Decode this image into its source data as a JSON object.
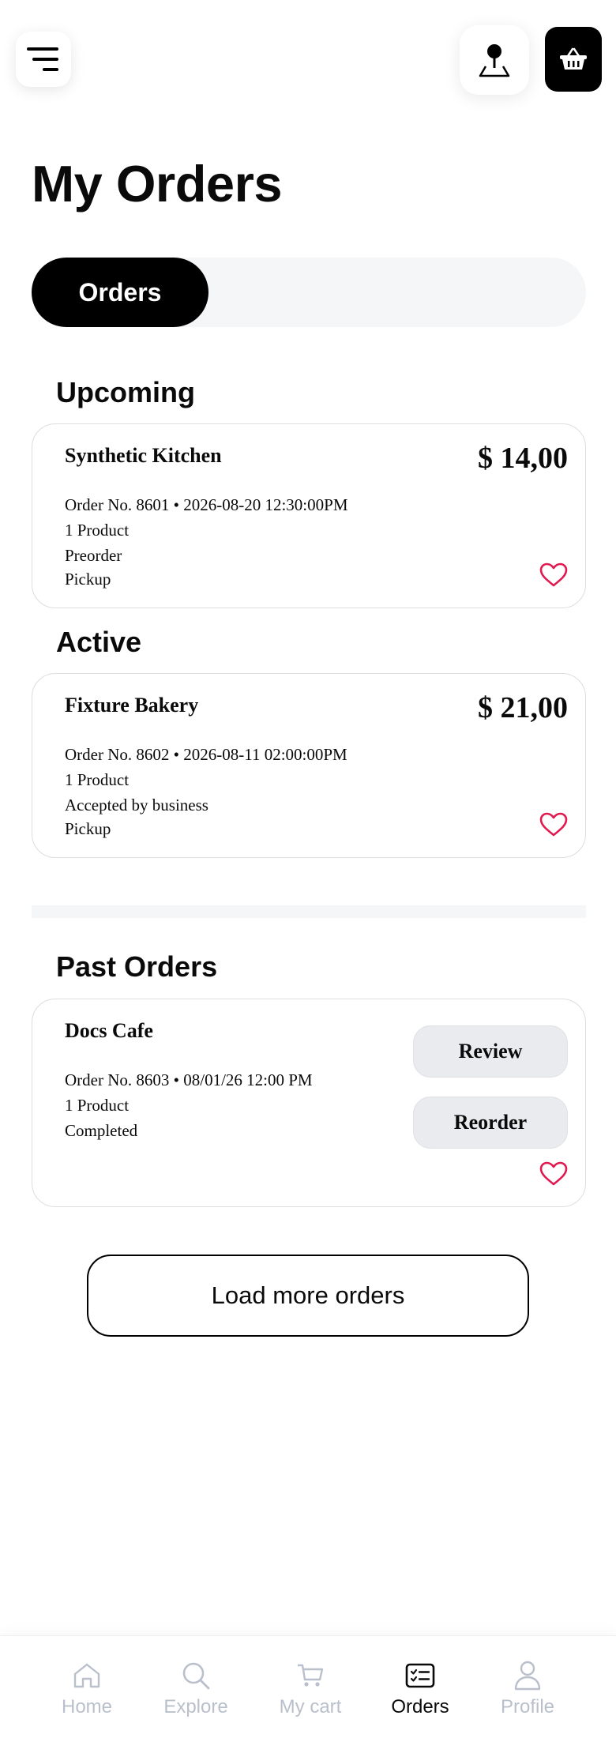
{
  "header": {
    "menu_icon": "menu-icon",
    "location_icon": "map-pin-icon",
    "cart_icon": "basket-icon"
  },
  "page_title": "My Orders",
  "tabs": [
    {
      "label": "Orders",
      "active": true
    }
  ],
  "sections": {
    "upcoming": "Upcoming",
    "active": "Active",
    "past": "Past Orders"
  },
  "orders": {
    "upcoming": [
      {
        "name": "Synthetic Kitchen",
        "price": "$ 14,00",
        "order_line": "Order No. 8601 • 2026-08-20 12:30:00PM",
        "products": "1 Product",
        "status": "Preorder",
        "method": "Pickup"
      }
    ],
    "active": [
      {
        "name": "Fixture Bakery",
        "price": "$ 21,00",
        "order_line": "Order No. 8602 • 2026-08-11 02:00:00PM",
        "products": "1 Product",
        "status": "Accepted by business",
        "method": "Pickup"
      }
    ],
    "past": [
      {
        "name": "Docs Cafe",
        "order_line": "Order No. 8603 • 08/01/26 12:00 PM",
        "products": "1 Product",
        "status": "Completed",
        "review_label": "Review",
        "reorder_label": "Reorder"
      }
    ]
  },
  "load_more_label": "Load more orders",
  "bottom_nav": [
    {
      "label": "Home",
      "icon": "home-icon",
      "active": false
    },
    {
      "label": "Explore",
      "icon": "search-icon",
      "active": false
    },
    {
      "label": "My cart",
      "icon": "cart-icon",
      "active": false
    },
    {
      "label": "Orders",
      "icon": "orders-icon",
      "active": true
    },
    {
      "label": "Profile",
      "icon": "profile-icon",
      "active": false
    }
  ],
  "colors": {
    "accent": "#000000",
    "heart": "#e0194f",
    "inactive_nav": "#b9c0cb",
    "track": "#f5f6f8"
  }
}
